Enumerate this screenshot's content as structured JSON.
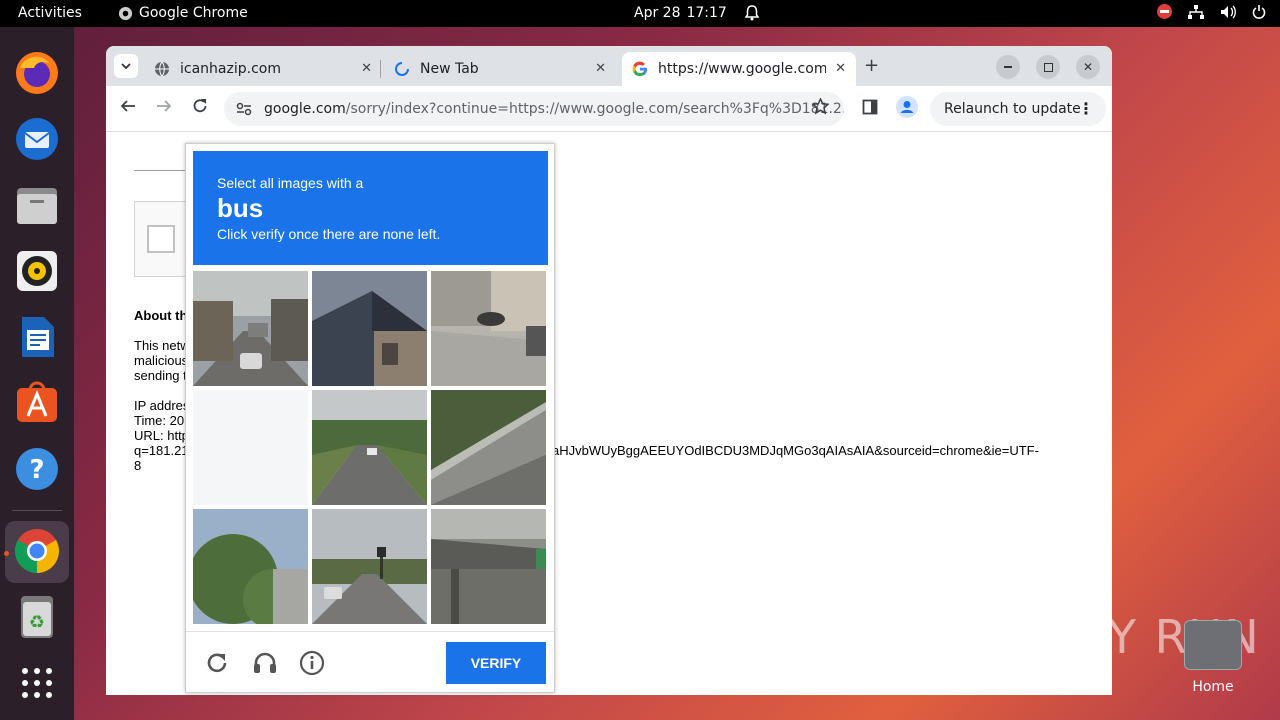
{
  "topbar": {
    "activities": "Activities",
    "app_name": "Google Chrome",
    "date": "Apr 28",
    "time": "17:17"
  },
  "tabs": [
    {
      "title": "icanhazip.com"
    },
    {
      "title": "New Tab"
    },
    {
      "title": "https://www.google.com"
    }
  ],
  "toolbar": {
    "url_domain": "google.com",
    "url_rest": "/sorry/index?continue=https://www.google.com/search%3Fq%3D181.2...",
    "relaunch_label": "Relaunch to update"
  },
  "page": {
    "about": "About th",
    "para1": "This netw",
    "para2": "malicious",
    "para3": "sending t",
    "ip": "IP addres",
    "time": "Time: 20",
    "url": "URL: http",
    "q": "q=181.21",
    "url_tail": "aHJvbWUyBggAEEUYOdIBCDU3MDJqMGo3qAIAsAIA&sourceid=chrome&ie=UTF-",
    "eight": "8"
  },
  "captcha": {
    "line1": "Select all images with a",
    "target": "bus",
    "line3": "Click verify once there are none left.",
    "verify_label": "VERIFY"
  },
  "desktop": {
    "home_label": "Home",
    "watermark": "ANY RUN"
  }
}
